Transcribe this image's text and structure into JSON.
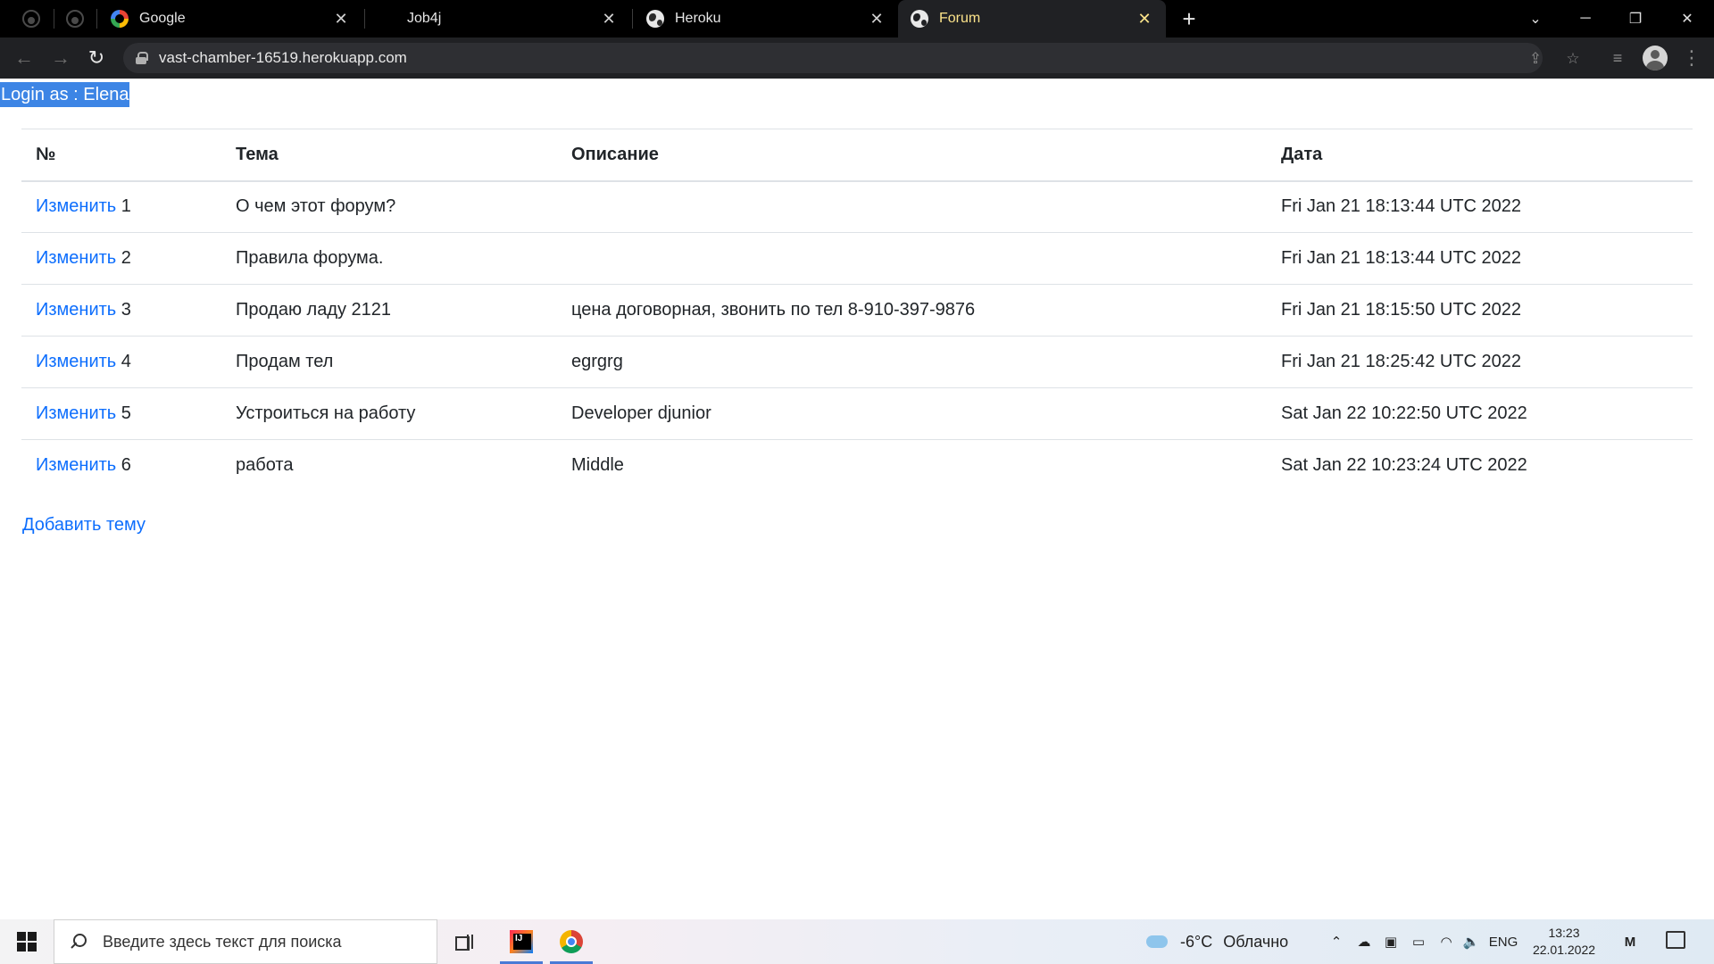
{
  "browser": {
    "tabs": [
      {
        "title": "Google",
        "icon": "google-icon",
        "active": false
      },
      {
        "title": "Job4j",
        "icon": "none",
        "active": false
      },
      {
        "title": "Heroku",
        "icon": "globe-icon",
        "active": false
      },
      {
        "title": "Forum",
        "icon": "globe-icon",
        "active": true
      }
    ],
    "close_glyph": "✕",
    "new_tab_glyph": "+",
    "url": "vast-chamber-16519.herokuapp.com"
  },
  "page": {
    "login_text": "Login as : Elena",
    "table": {
      "headers": {
        "num": "№",
        "topic": "Тема",
        "description": "Описание",
        "date": "Дата"
      },
      "edit_label": "Изменить",
      "rows": [
        {
          "id": "1",
          "topic": "О чем этот форум?",
          "description": "",
          "date": "Fri Jan 21 18:13:44 UTC 2022"
        },
        {
          "id": "2",
          "topic": "Правила форума.",
          "description": "",
          "date": "Fri Jan 21 18:13:44 UTC 2022"
        },
        {
          "id": "3",
          "topic": "Продаю ладу 2121",
          "description": "цена договорная, звонить по тел 8-910-397-9876",
          "date": "Fri Jan 21 18:15:50 UTC 2022"
        },
        {
          "id": "4",
          "topic": "Продам тел",
          "description": "egrgrg",
          "date": "Fri Jan 21 18:25:42 UTC 2022"
        },
        {
          "id": "5",
          "topic": "Устроиться на работу",
          "description": "Developer djunior",
          "date": "Sat Jan 22 10:22:50 UTC 2022"
        },
        {
          "id": "6",
          "topic": "работа",
          "description": "Middle",
          "date": "Sat Jan 22 10:23:24 UTC 2022"
        }
      ]
    },
    "add_topic_label": "Добавить тему"
  },
  "taskbar": {
    "search_placeholder": "Введите здесь текст для поиска",
    "weather_temp": "-6°C",
    "weather_desc": "Облачно",
    "language": "ENG",
    "time": "13:23",
    "date": "22.01.2022"
  },
  "colors": {
    "link": "#0d6efd",
    "selection": "#3d85e5",
    "active_tab_text": "#fce38a"
  }
}
